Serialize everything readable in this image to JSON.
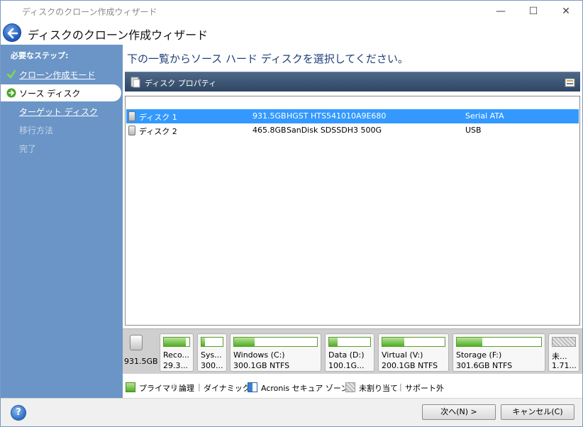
{
  "window": {
    "title": "ディスクのクローン作成ウィザード",
    "heading": "ディスクのクローン作成ウィザード",
    "controls": {
      "minimize": "—",
      "maximize": "☐",
      "close": "✕"
    }
  },
  "sidebar": {
    "steps_label": "必要なステップ:",
    "items": [
      {
        "label": "クローン作成モード",
        "state": "done"
      },
      {
        "label": "ソース ディスク",
        "state": "active"
      },
      {
        "label": "ターゲット ディスク",
        "state": "link"
      },
      {
        "label": "移行方法",
        "state": "disabled"
      },
      {
        "label": "完了",
        "state": "disabled"
      }
    ]
  },
  "main": {
    "instruction": "下の一覧からソース ハード ディスクを選択してください。",
    "grid_header": "ディスク プロパティ",
    "disks": [
      {
        "name": "ディスク 1",
        "capacity": "931.5GB",
        "model": "HGST HTS541010A9E680",
        "interface": "Serial ATA",
        "selected": true
      },
      {
        "name": "ディスク 2",
        "capacity": "465.8GB",
        "model": "SanDisk SDSSDH3 500G",
        "interface": "USB",
        "selected": false
      }
    ]
  },
  "partition_bar": {
    "disk_capacity": "931.5GB",
    "partitions": [
      {
        "name": "Reco...",
        "size": "29.3...",
        "fill": 0.85,
        "type": "primary"
      },
      {
        "name": "Sys...",
        "size": "300...",
        "fill": 0.15,
        "type": "primary"
      },
      {
        "name": "Windows (C:)",
        "size": "300.1GB  NTFS",
        "fill": 0.25,
        "type": "primary"
      },
      {
        "name": "Data (D:)",
        "size": "100.1G...",
        "fill": 0.2,
        "type": "primary"
      },
      {
        "name": "Virtual (V:)",
        "size": "200.1GB  NTFS",
        "fill": 0.35,
        "type": "primary"
      },
      {
        "name": "Storage (F:)",
        "size": "301.6GB  NTFS",
        "fill": 0.3,
        "type": "primary"
      },
      {
        "name": "未...",
        "size": "1.71...",
        "fill": 0,
        "type": "unallocated"
      }
    ]
  },
  "legend": {
    "primary": "プライマリ",
    "logical": "論理",
    "dynamic": "ダイナミック",
    "acronis_zone": "Acronis セキュア ゾーン",
    "unallocated": "未割り当て",
    "unsupported": "サポート外",
    "separator": "|"
  },
  "footer": {
    "help": "?",
    "next_label": "次へ(N) >",
    "cancel_label": "キャンセル(C)"
  },
  "colors": {
    "sidebar": "#6b95c6",
    "selection": "#3399ff",
    "partition_green": "#4fae24",
    "acronis_blue": "#3b7fd4"
  }
}
